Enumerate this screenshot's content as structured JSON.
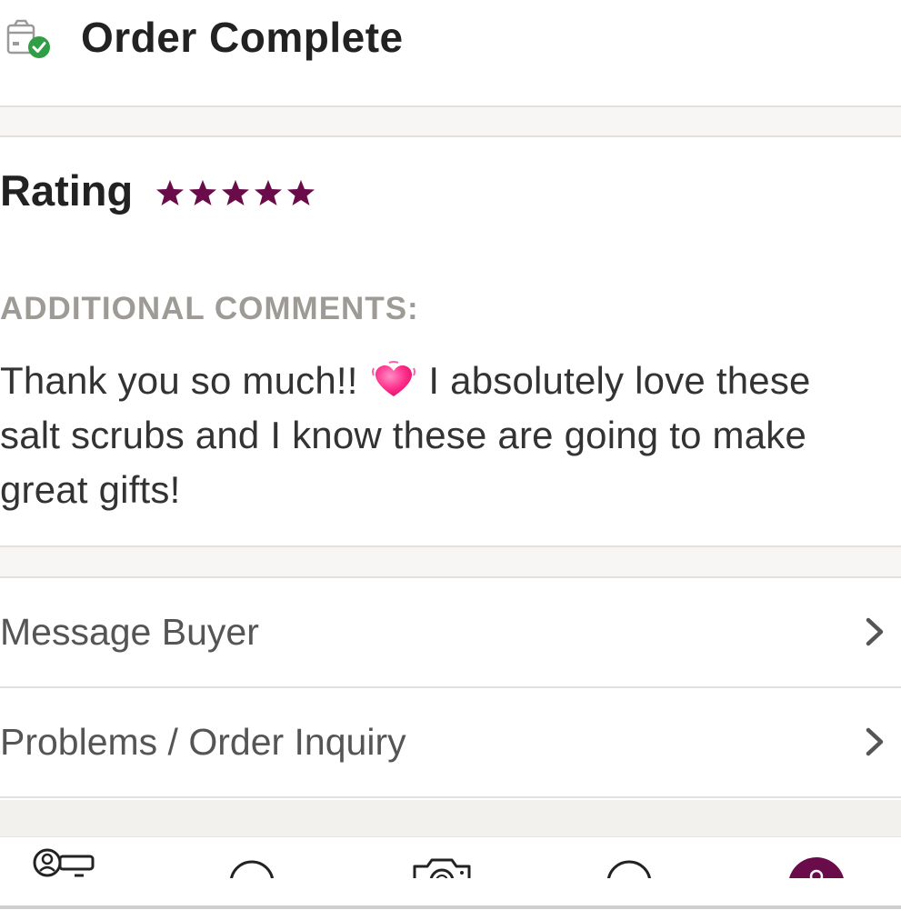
{
  "header": {
    "title": "Order Complete",
    "icon": "package-check-icon"
  },
  "rating": {
    "label": "Rating",
    "value": 5,
    "max": 5,
    "star_color": "#6b0c4a"
  },
  "comments": {
    "label": "ADDITIONAL COMMENTS:",
    "text_before_emoji": "Thank you so much!! ",
    "emoji": "beating-heart-icon",
    "text_line1_after": " I absolutely love these",
    "text_line2": "salt scrubs and I know these are going to make",
    "text_line3": "great gifts!"
  },
  "actions": [
    {
      "label": "Message Buyer",
      "icon": "chevron-right-icon"
    },
    {
      "label": "Problems / Order Inquiry",
      "icon": "chevron-right-icon"
    }
  ],
  "tabbar": {
    "tabs": [
      {
        "icon": "profile-card-icon"
      },
      {
        "icon": "circle-icon"
      },
      {
        "icon": "camera-icon"
      },
      {
        "icon": "circle-outline-icon"
      },
      {
        "icon": "account-active-icon"
      }
    ],
    "active_color": "#6b0c4a"
  }
}
